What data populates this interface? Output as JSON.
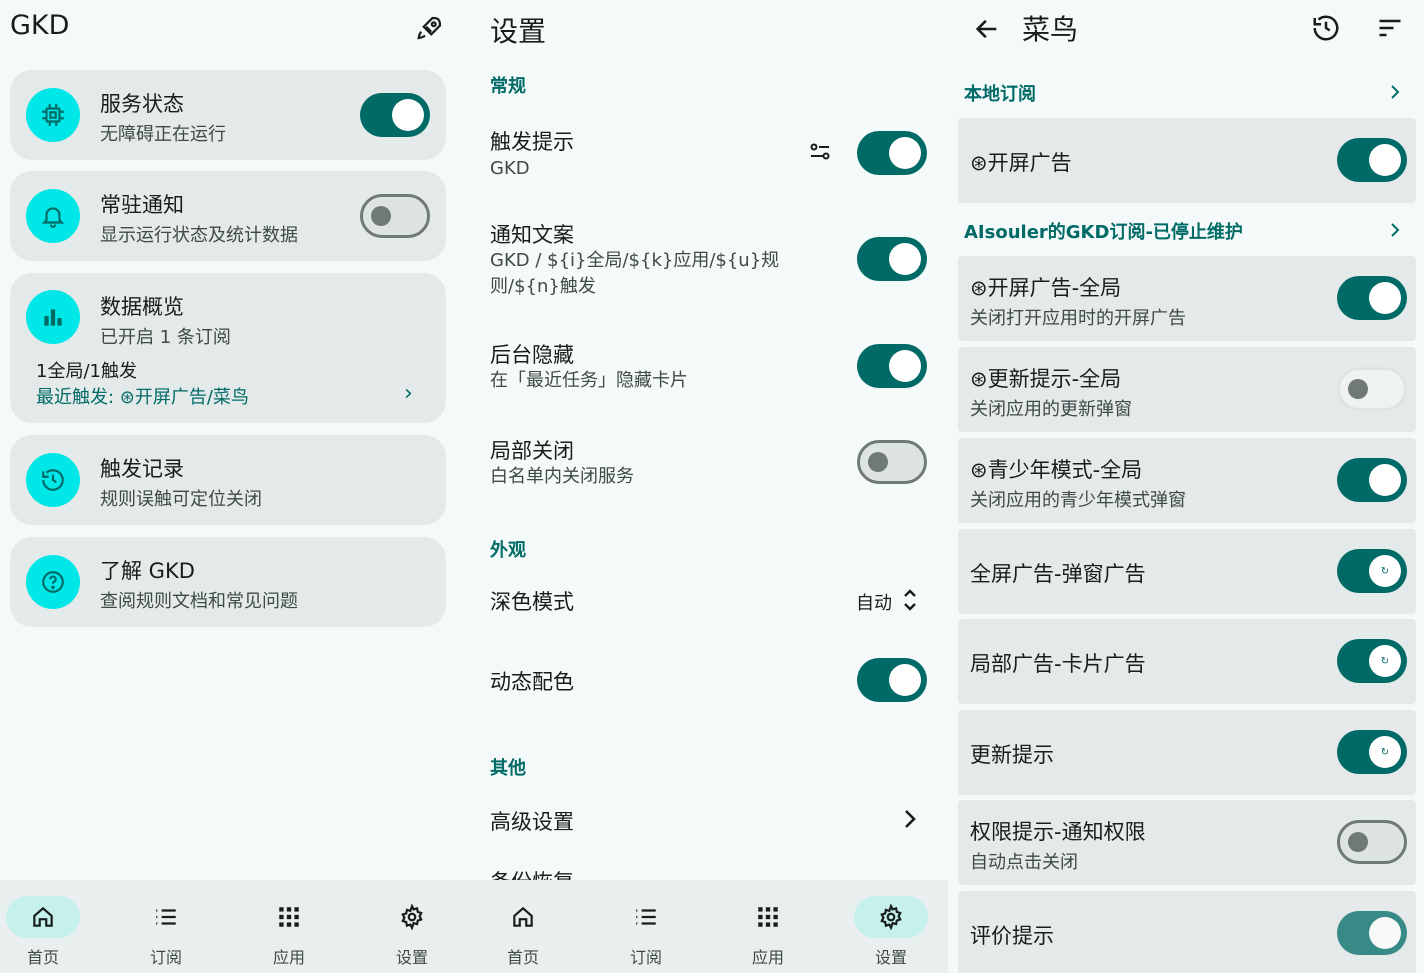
{
  "home": {
    "app_title": "GKD",
    "rocket_icon": "rocket-icon",
    "cards": [
      {
        "title": "服务状态",
        "subtitle": "无障碍正在运行",
        "toggle": true
      },
      {
        "title": "常驻通知",
        "subtitle": "显示运行状态及统计数据",
        "toggle": false
      },
      {
        "title": "数据概览",
        "subtitle": "已开启 1 条订阅",
        "line1": "1全局/1触发",
        "line2": "最近触发: ⊛开屏广告/菜鸟",
        "chevron": "›"
      },
      {
        "title": "触发记录",
        "subtitle": "规则误触可定位关闭"
      },
      {
        "title": "了解 GKD",
        "subtitle": "查阅规则文档和常见问题"
      }
    ]
  },
  "settings": {
    "title": "设置",
    "sections": {
      "general": "常规",
      "appearance": "外观",
      "other": "其他"
    },
    "items": [
      {
        "title": "触发提示",
        "subtitle": "GKD",
        "toggle": true
      },
      {
        "title": "通知文案",
        "subtitle": "GKD / ${i}全局/${k}应用/${u}规则/${n}触发",
        "toggle": true
      },
      {
        "title": "后台隐藏",
        "subtitle": "在「最近任务」隐藏卡片",
        "toggle": true
      },
      {
        "title": "局部关闭",
        "subtitle": "白名单内关闭服务",
        "toggle": false
      },
      {
        "title": "深色模式",
        "value": "自动"
      },
      {
        "title": "动态配色",
        "toggle": true
      },
      {
        "title": "高级设置"
      },
      {
        "title": "备份恢复"
      }
    ]
  },
  "app_rules": {
    "title": "菜鸟",
    "groups": [
      {
        "name": "本地订阅"
      },
      {
        "name": "AIsouler的GKD订阅-已停止维护"
      }
    ],
    "rules": [
      {
        "title": "⊛开屏广告",
        "subtitle": "",
        "toggle": true
      },
      {
        "title": "⊛开屏广告-全局",
        "subtitle": "关闭打开应用时的开屏广告",
        "toggle": true
      },
      {
        "title": "⊛更新提示-全局",
        "subtitle": "关闭应用的更新弹窗",
        "toggle": false
      },
      {
        "title": "⊛青少年模式-全局",
        "subtitle": "关闭应用的青少年模式弹窗",
        "toggle": true
      },
      {
        "title": "全屏广告-弹窗广告",
        "subtitle": "",
        "toggle": true
      },
      {
        "title": "局部广告-卡片广告",
        "subtitle": "",
        "toggle": true
      },
      {
        "title": "更新提示",
        "subtitle": "",
        "toggle": true
      },
      {
        "title": "权限提示-通知权限",
        "subtitle": "自动点击关闭",
        "toggle": false
      },
      {
        "title": "评价提示",
        "subtitle": "",
        "toggle": true
      }
    ]
  },
  "nav": {
    "home": "首页",
    "subs": "订阅",
    "apps": "应用",
    "settings": "设置"
  },
  "colors": {
    "accent": "#006a66",
    "cyan": "#00e7e7",
    "card": "#e3eae9",
    "background": "#f3faf9"
  }
}
